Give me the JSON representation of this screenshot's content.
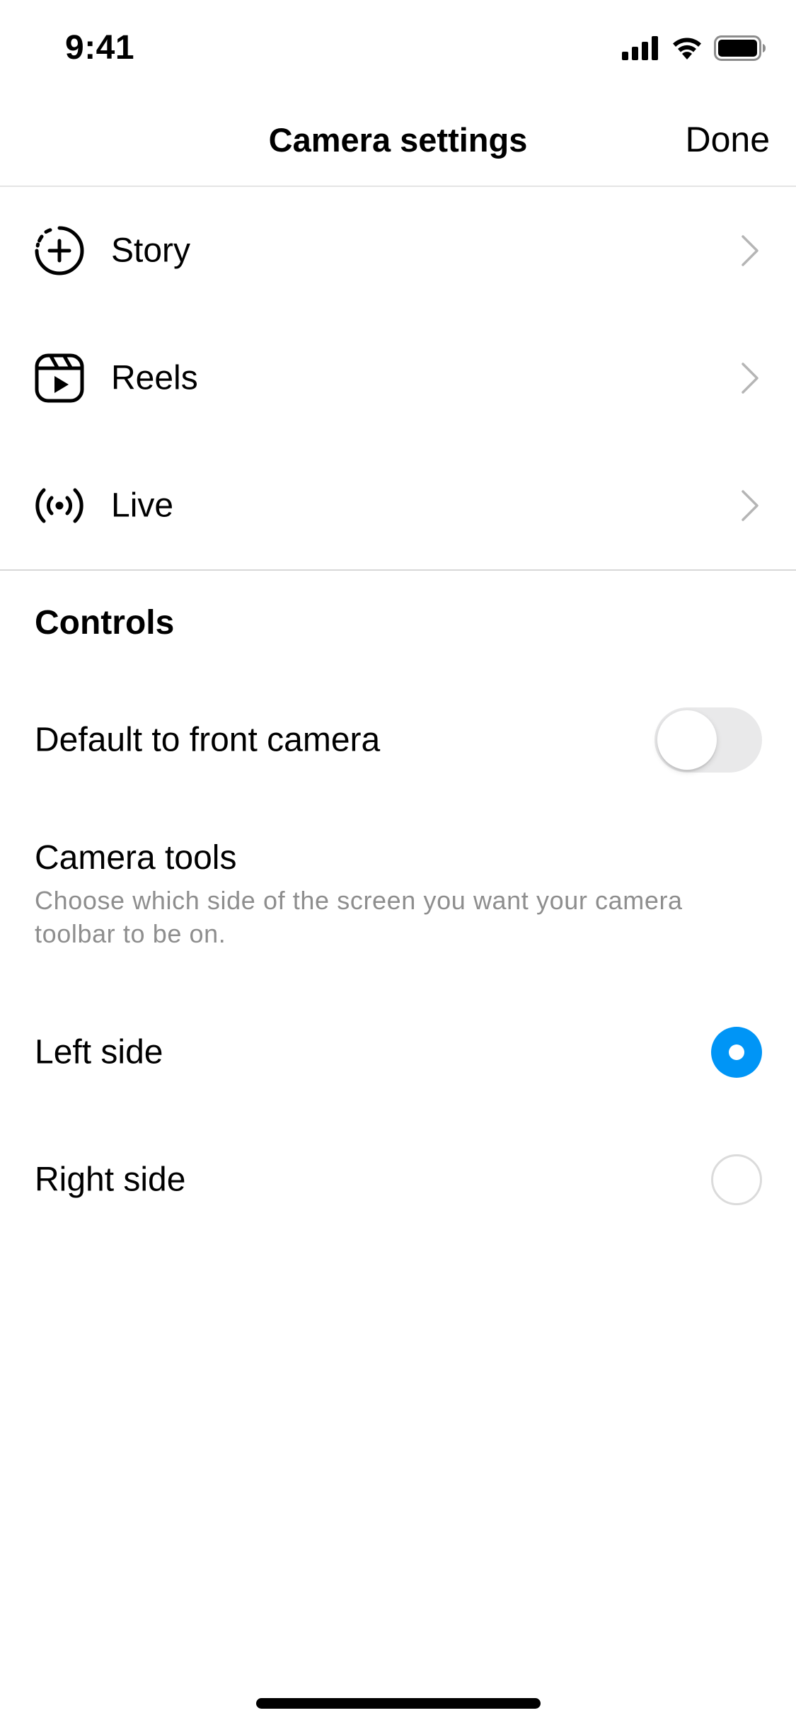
{
  "status_bar": {
    "time": "9:41",
    "icons": [
      "cellular-signal-icon",
      "wifi-icon",
      "battery-icon"
    ]
  },
  "header": {
    "title": "Camera settings",
    "done_label": "Done"
  },
  "camera_modes": [
    {
      "label": "Story",
      "icon": "story-add-icon"
    },
    {
      "label": "Reels",
      "icon": "reels-icon"
    },
    {
      "label": "Live",
      "icon": "live-broadcast-icon"
    }
  ],
  "controls": {
    "heading": "Controls",
    "front_camera": {
      "label": "Default to front camera",
      "enabled": false
    },
    "camera_tools": {
      "title": "Camera tools",
      "description": "Choose which side of the screen you want your camera toolbar to be on."
    },
    "toolbar_side": {
      "options": [
        {
          "label": "Left side",
          "selected": true
        },
        {
          "label": "Right side",
          "selected": false
        }
      ]
    }
  },
  "colors": {
    "accent": "#0095f6",
    "secondary_text": "#8e8e8e",
    "toggle_off": "#e9e9ea"
  }
}
